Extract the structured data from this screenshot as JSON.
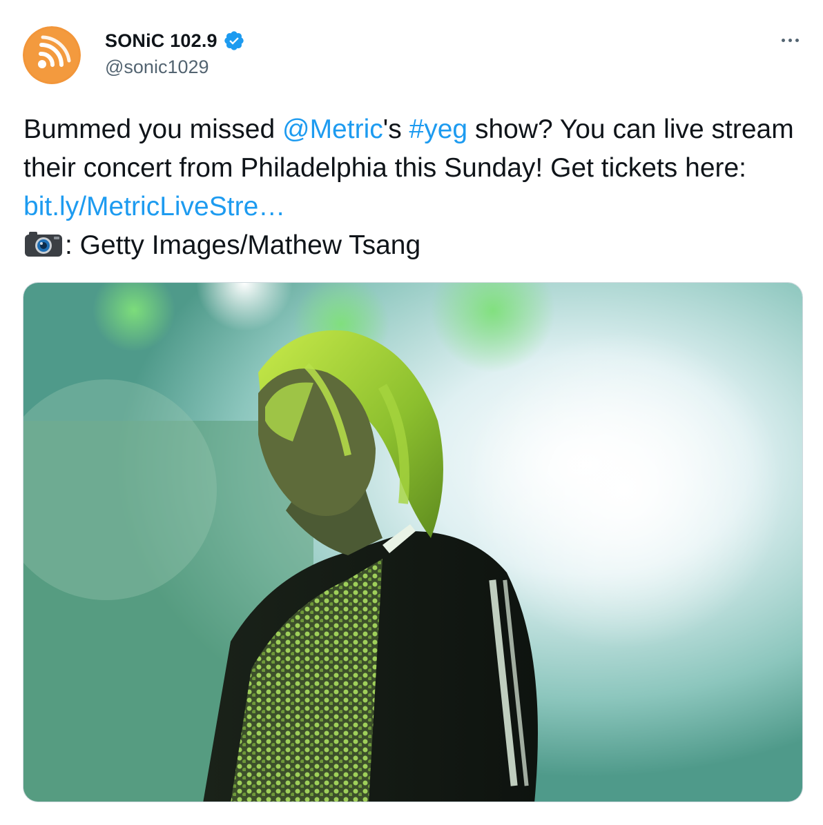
{
  "account": {
    "display_name": "SONiC 102.9",
    "handle": "@sonic1029",
    "avatar_icon": "radio-waves-logo",
    "verified_icon": "verified-badge-icon",
    "brand_color": "#F2963A"
  },
  "menu": {
    "icon": "more-horizontal-icon"
  },
  "tweet": {
    "text_1": "Bummed you missed ",
    "mention": "@Metric",
    "text_2": "'s ",
    "hashtag": "#yeg",
    "text_3": " show? You can live stream their concert from Philadelphia this Sunday! Get tickets here: ",
    "link": "bit.ly/MetricLiveStre…",
    "camera_icon": "camera-emoji-icon",
    "credit": ": Getty Images/Mathew Tsang",
    "link_color": "#1D9BF0"
  },
  "media": {
    "icon": "concert-photo",
    "dominant_colors": [
      "#5FAE7E",
      "#E8F3F4",
      "#1F2B22",
      "#9FD23A"
    ]
  }
}
